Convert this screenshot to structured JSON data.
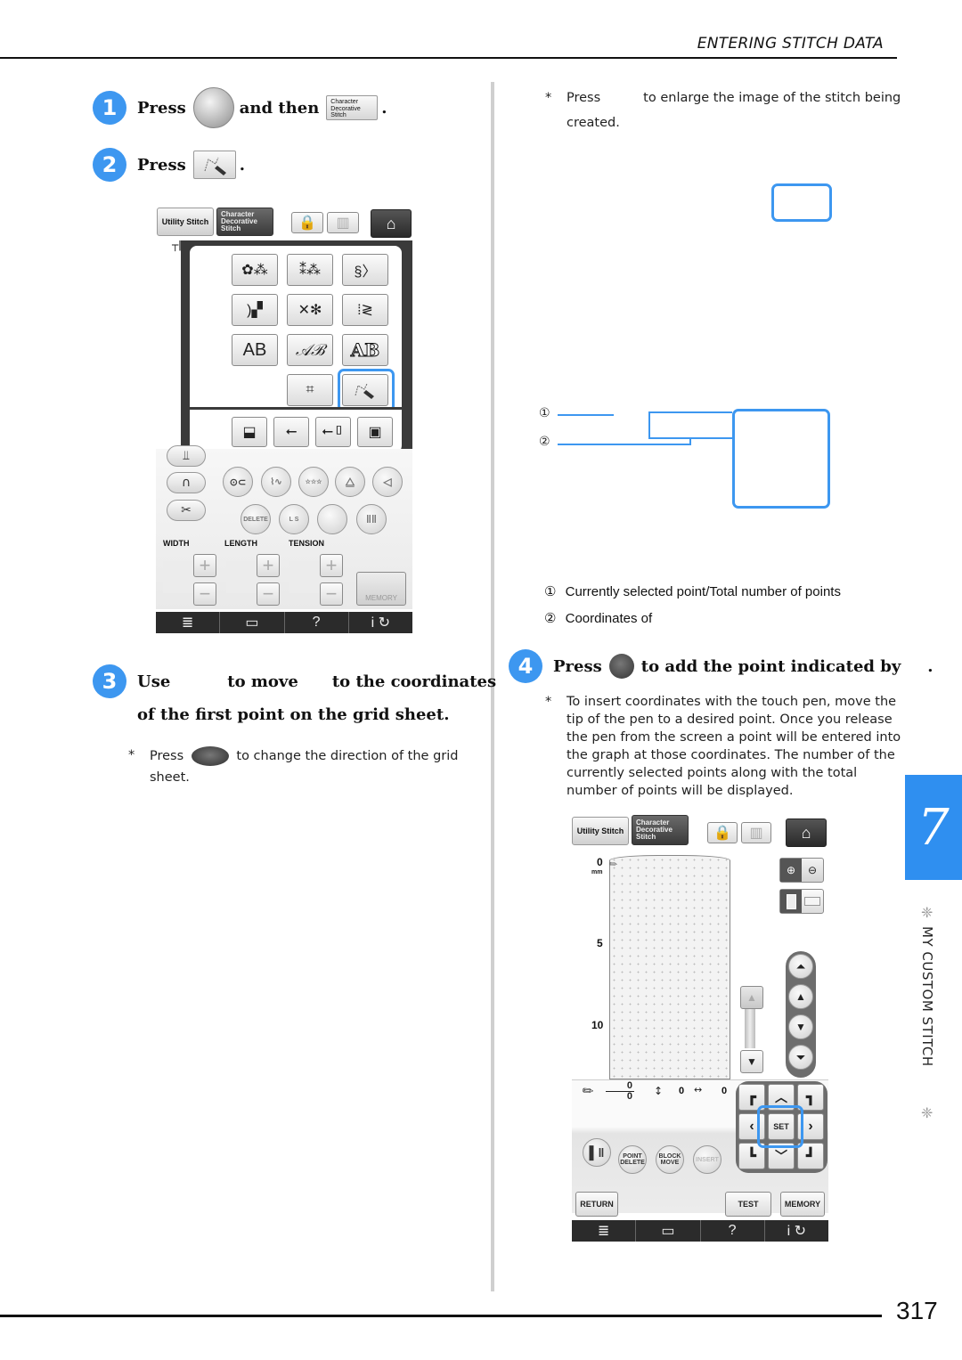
{
  "header": {
    "title": "ENTERING STITCH DATA"
  },
  "steps": {
    "s1": {
      "num": "1",
      "press": "Press",
      "and_then": "and then",
      "char_btn": [
        "Character",
        "Decorative",
        "Stitch"
      ],
      "period": "."
    },
    "s2": {
      "num": "2",
      "press": "Press",
      "period": "."
    },
    "s3": {
      "num": "3",
      "line1_a": "Use",
      "line1_b": "to move",
      "line1_c": "to the coordinates",
      "line2": "of the first point on the grid sheet.",
      "note_star": "*",
      "note_press": "Press",
      "note_rest": "to change the direction of the grid",
      "note_line2": "sheet."
    },
    "s4": {
      "num": "4",
      "press": "Press",
      "rest": "to add the point indicated by",
      "period": ".",
      "note_star": "*",
      "note_lines": [
        "To insert coordinates with the touch pen, move the",
        "tip of the pen to a desired point. Once you release",
        "the pen from the screen a point will be entered into",
        "the graph at those coordinates. The number of the",
        "currently selected points along with the total",
        "number of points will be displayed."
      ]
    }
  },
  "right_note": {
    "star": "*",
    "press": "Press",
    "rest": "to enlarge the image of the stitch being",
    "line2": "created."
  },
  "callouts": {
    "c1": "①",
    "c2": "②"
  },
  "legend": [
    {
      "num": "①",
      "text": "Currently selected point/Total number of points"
    },
    {
      "num": "②",
      "text": "Coordinates of"
    }
  ],
  "screen1": {
    "tab_utility": "Utility Stitch",
    "tab_char": [
      "Character",
      "Decorative",
      "Stitch"
    ],
    "grid_buttons": [
      "AB",
      "𝒜ℬ",
      "AB"
    ],
    "round_buttons": [
      "DELETE",
      "L  S",
      "",
      ""
    ],
    "labels": {
      "width": "WIDTH",
      "length": "LENGTH",
      "tension": "TENSION"
    },
    "plus": "+",
    "minus": "−",
    "memory": "MEMORY",
    "bottom_bar": [
      "≣",
      "▭",
      "?",
      "i ↻"
    ]
  },
  "screen2": {
    "tab_utility": "Utility Stitch",
    "tab_char": [
      "Character",
      "Decorative",
      "Stitch"
    ],
    "axis": {
      "zero": "0",
      "unit": "mm",
      "five": "5",
      "ten": "10"
    },
    "counter": {
      "current": "0",
      "total": "0"
    },
    "coord_y": "0",
    "coord_x": "0",
    "set": "SET",
    "point_delete": [
      "POINT",
      "DELETE"
    ],
    "block_move": [
      "BLOCK",
      "MOVE"
    ],
    "insert": "INSERT",
    "return": "RETURN",
    "test": "TEST",
    "memory": "MEMORY",
    "bottom_bar": [
      "≣",
      "▭",
      "?",
      "i ↻"
    ]
  },
  "chapter": {
    "number": "7",
    "title": "MY CUSTOM STITCH"
  },
  "page_number": "317",
  "colors": {
    "accent": "#3d97f0",
    "chapter_tab": "#2f8ff0"
  }
}
